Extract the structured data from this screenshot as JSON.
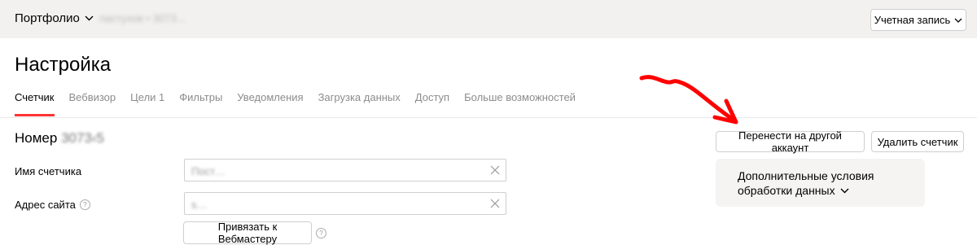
{
  "header": {
    "portfolio_label": "Портфолио",
    "identity_blurred": "пастухов • 3073…",
    "account_label": "Учетная запись"
  },
  "page": {
    "title": "Настройка"
  },
  "tabs": [
    {
      "label": "Счетчик",
      "active": true
    },
    {
      "label": "Вебвизор",
      "active": false
    },
    {
      "label": "Цели 1",
      "active": false
    },
    {
      "label": "Фильтры",
      "active": false
    },
    {
      "label": "Уведомления",
      "active": false
    },
    {
      "label": "Загрузка данных",
      "active": false
    },
    {
      "label": "Доступ",
      "active": false
    },
    {
      "label": "Больше возможностей",
      "active": false
    }
  ],
  "counter": {
    "number_label": "Номер",
    "number_value_blurred": "3073‹5"
  },
  "form": {
    "name_label": "Имя счетчика",
    "name_value_blurred": "Пост…",
    "site_label": "Адрес сайта",
    "site_value_blurred": "s…",
    "webmaster_button": "Привязать к Вебмастеру"
  },
  "actions": {
    "transfer_button": "Перенести на другой аккаунт",
    "delete_button": "Удалить счетчик"
  },
  "extra_conditions": {
    "line1": "Дополнительные условия",
    "line2": "обработки данных"
  },
  "colors": {
    "accent": "#ff3333",
    "annotation_arrow": "#ff0000",
    "topbar_bg": "#f2f1f0",
    "panel_bg": "#f5f4f2"
  }
}
